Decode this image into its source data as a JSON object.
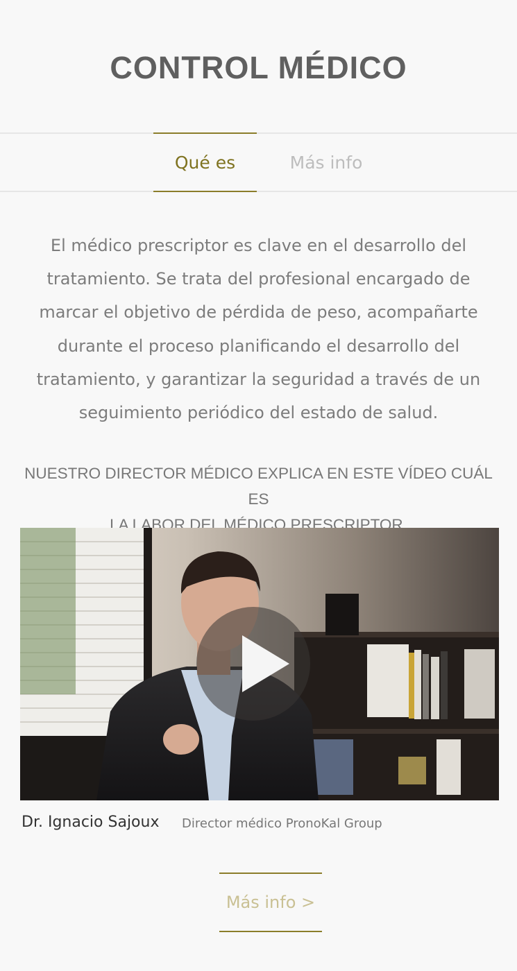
{
  "page": {
    "title": "CONTROL MÉDICO"
  },
  "tabs": [
    {
      "label": "Qué es",
      "active": true
    },
    {
      "label": "Más info",
      "active": false
    }
  ],
  "intro": {
    "lines": [
      "El médico prescriptor es clave en el desarrollo del",
      "tratamiento. Se trata del profesional encargado de",
      "marcar el objetivo de pérdida de peso, acompañarte",
      "durante el proceso planificando el desarrollo del",
      "tratamiento, y garantizar la seguridad a través de un",
      "seguimiento periódico del estado de salud."
    ]
  },
  "video_heading": {
    "lines": [
      "NUESTRO DIRECTOR MÉDICO EXPLICA EN ESTE VÍDEO CUÁL ES",
      "LA LABOR DEL MÉDICO PRESCRIPTOR."
    ]
  },
  "video": {
    "play_icon": "play-icon"
  },
  "caption": {
    "name": "Dr. Ignacio Sajoux",
    "role": "Director médico PronoKal Group"
  },
  "more_link": {
    "label": "Más info >"
  },
  "colors": {
    "accent": "#8b7d2a",
    "accent_text": "#7f7320",
    "link_text": "#c9c093",
    "background": "#f8f8f8"
  }
}
